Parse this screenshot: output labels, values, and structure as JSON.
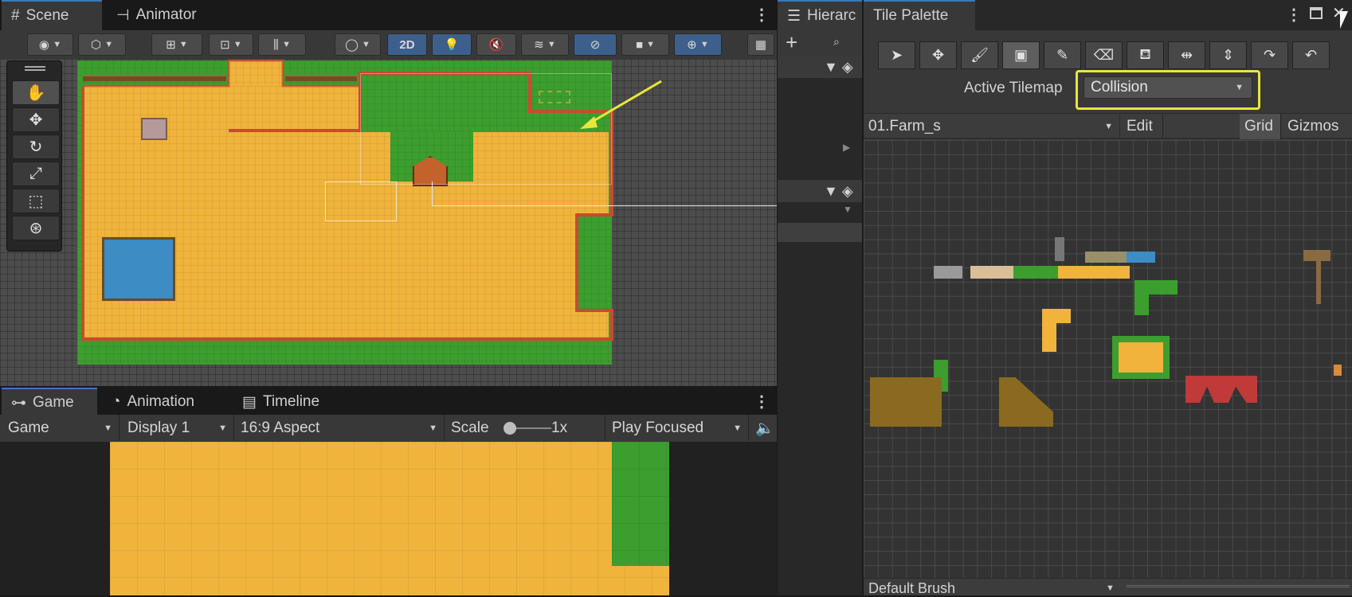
{
  "scene_window": {
    "tabs": [
      {
        "label": "Scene",
        "icon": "grid-icon"
      },
      {
        "label": "Animator",
        "icon": "animator-icon"
      }
    ],
    "toolbar": {
      "mode_2d_label": "2D"
    }
  },
  "game_window": {
    "tabs": [
      {
        "label": "Game",
        "icon": "gamepad-icon"
      },
      {
        "label": "Animation",
        "icon": "clock-icon"
      },
      {
        "label": "Timeline",
        "icon": "film-icon"
      }
    ],
    "bar": {
      "game": "Game",
      "display": "Display 1",
      "aspect": "16:9 Aspect",
      "scale_label": "Scale",
      "scale_value": "1x",
      "play": "Play Focused"
    }
  },
  "hierarchy": {
    "tab_label": "Hierarc",
    "add_label": "+"
  },
  "tile_palette": {
    "tab_label": "Tile Palette",
    "tools": [
      "select-icon",
      "move-icon",
      "paint-brush-icon",
      "box-fill-icon",
      "picker-icon",
      "eraser-icon",
      "fill-bucket-icon",
      "flip-x-icon",
      "flip-y-icon",
      "rotate-cw-icon",
      "rotate-ccw-icon"
    ],
    "active_tilemap_label": "Active Tilemap",
    "active_tilemap_value": "Collision",
    "palette_name": "01.Farm_s",
    "edit_label": "Edit",
    "grid_label": "Grid",
    "gizmos_label": "Gizmos",
    "brush_label": "Default Brush"
  },
  "colors": {
    "highlight": "#e9e63a",
    "accent": "#3a79bb",
    "sand": "#f0b33c",
    "grass": "#3c9e2e",
    "water": "#3d8cc4",
    "collision": "#c84a30"
  }
}
